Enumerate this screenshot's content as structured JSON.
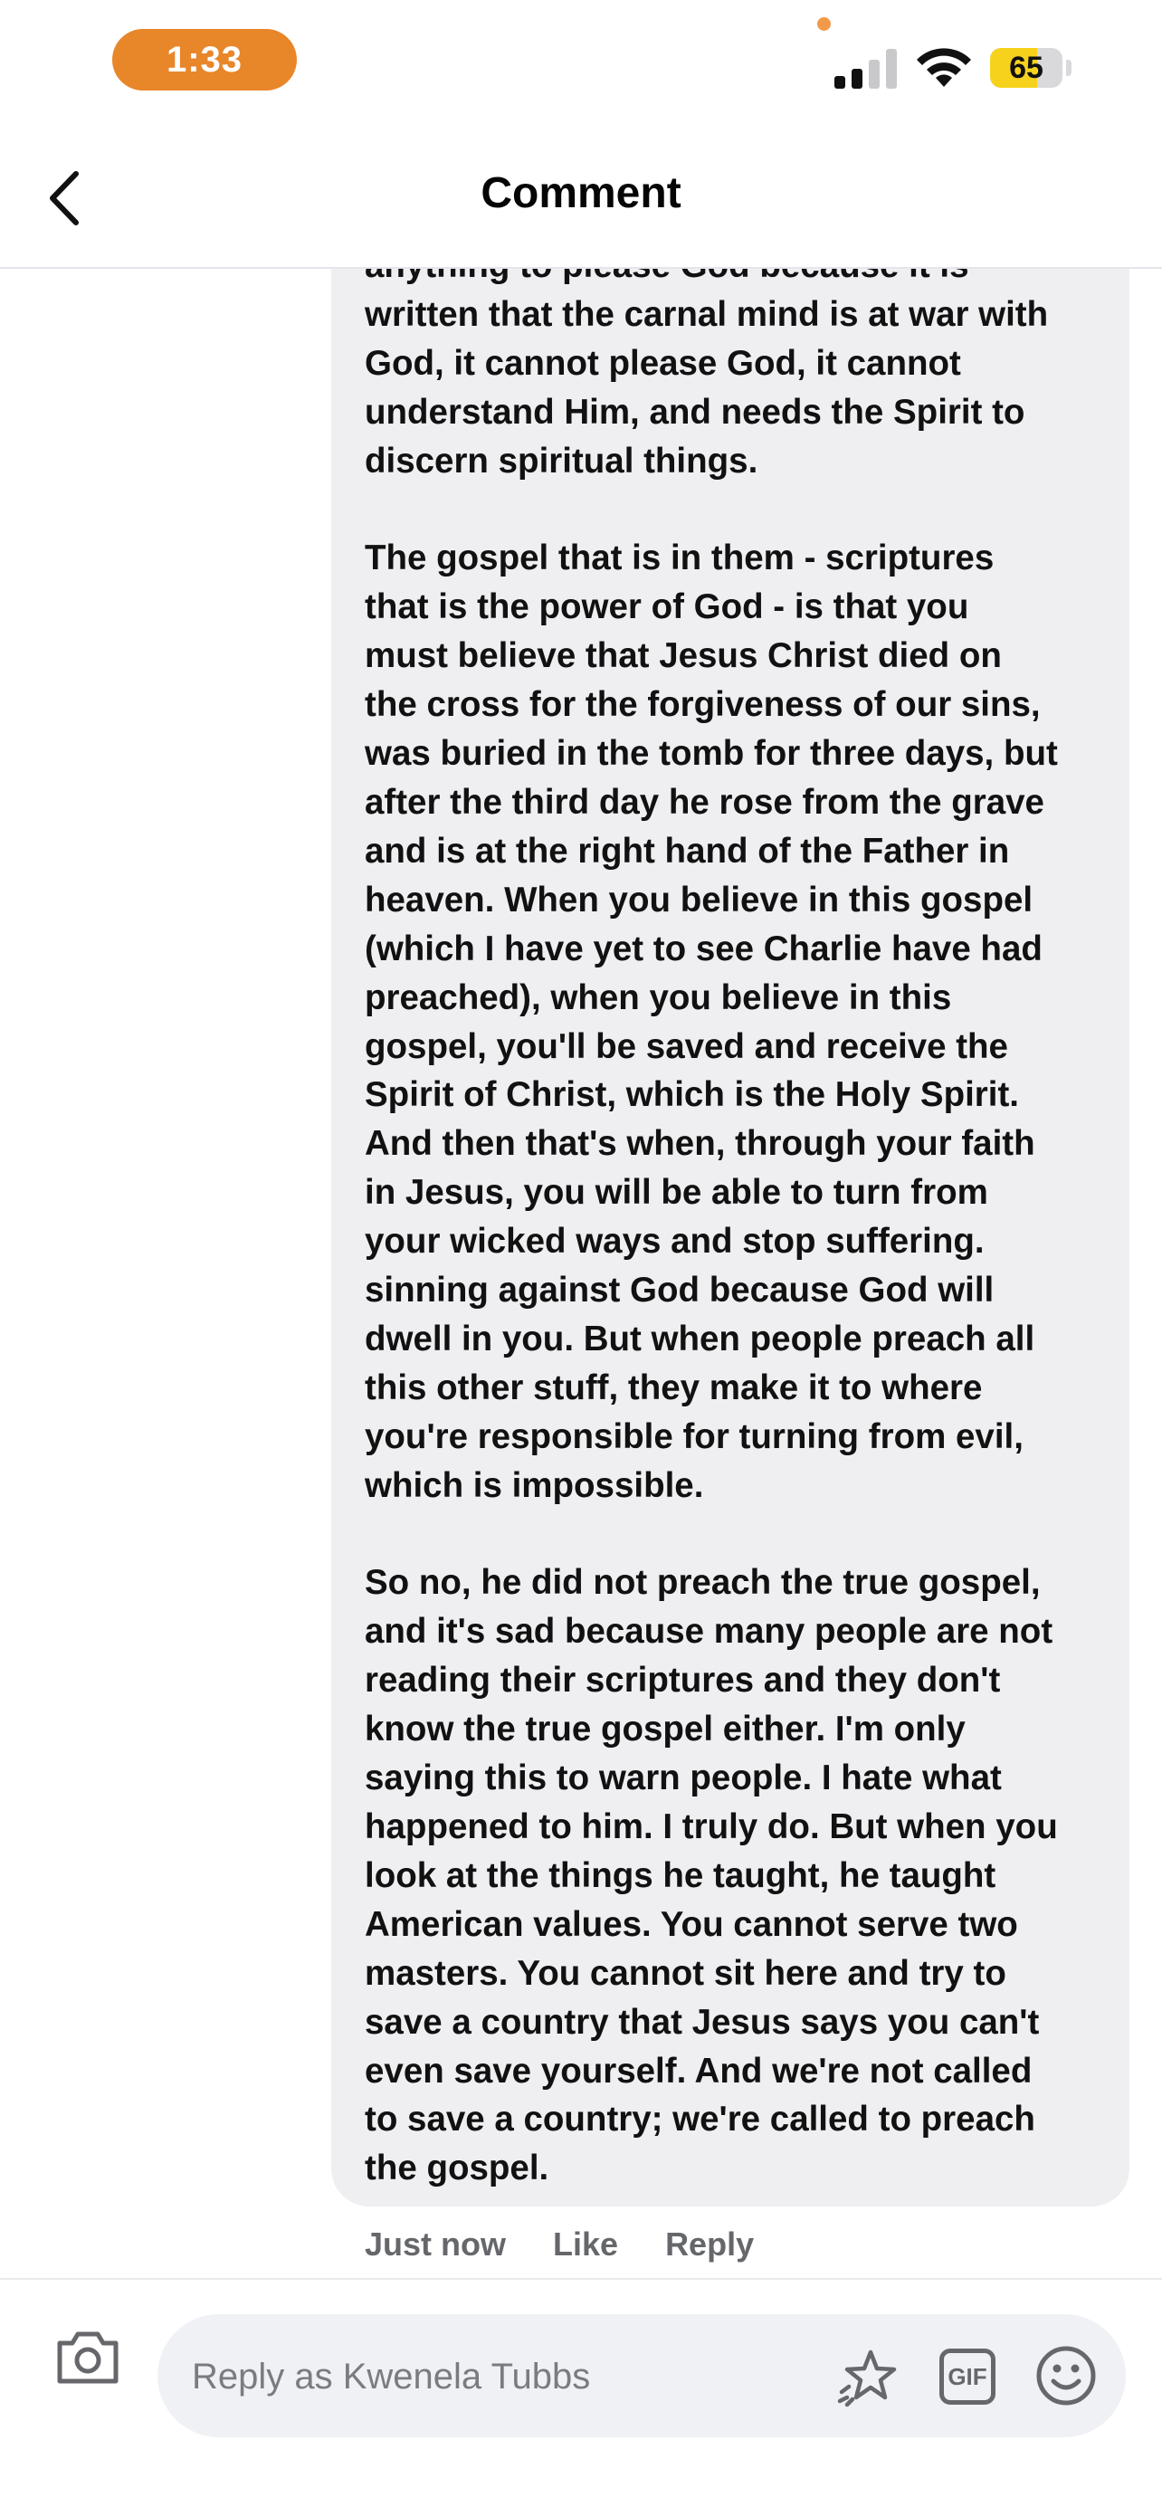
{
  "status_bar": {
    "time": "1:33",
    "battery_level": "65",
    "battery_fraction": 0.65,
    "cellular_signal_bars": 2,
    "cellular_signal_total": 4
  },
  "header": {
    "title": "Comment"
  },
  "comment": {
    "text": "anything to please God because it is\nwritten that the carnal mind is at war with\nGod, it cannot please God, it cannot\nunderstand Him, and needs the Spirit to\ndiscern spiritual things.\n\nThe gospel that is in them - scriptures\nthat is the power of God - is that you\nmust believe that Jesus Christ died on\nthe cross for the forgiveness of our sins,\nwas buried in the tomb for three days, but\nafter the third day he rose from the grave\nand is at the right hand of the Father in\nheaven. When you believe in this gospel\n(which I have yet to see Charlie have had\npreached), when you believe in this\ngospel, you'll be saved and receive the\nSpirit of Christ, which is the Holy Spirit.\nAnd then that's when, through your faith\nin Jesus, you will be able to turn from\nyour wicked ways and stop suffering.\nsinning against God because God will\ndwell in you. But when people preach all\nthis other stuff, they make it to where\nyou're responsible for turning from evil,\nwhich is impossible.\n\nSo no, he did not preach the true gospel,\nand it's sad because many people are not\nreading their scriptures and they don't\nknow the true gospel either. I'm only\nsaying this to warn people. I hate what\nhappened to him. I truly do. But when you\nlook at the things he taught, he taught\nAmerican values. You cannot serve two\nmasters. You cannot sit here and try to\nsave a country that Jesus says you can't\neven save yourself. And we're not called\nto save a country; we're called to preach\nthe gospel.",
    "timestamp": "Just now",
    "like_label": "Like",
    "reply_label": "Reply"
  },
  "composer": {
    "placeholder": "Reply as Kwenela Tubbs",
    "gif_label": "GIF"
  },
  "icons": {
    "back": "chevron-left-icon",
    "camera": "camera-icon",
    "sticker": "sticker-icon",
    "gif": "gif-icon",
    "emoji": "emoji-icon"
  },
  "colors": {
    "time_pill": "#e8862a",
    "battery_fill": "#f6d21d",
    "bubble_bg": "#efeff2",
    "secondary_text": "#65676b"
  }
}
